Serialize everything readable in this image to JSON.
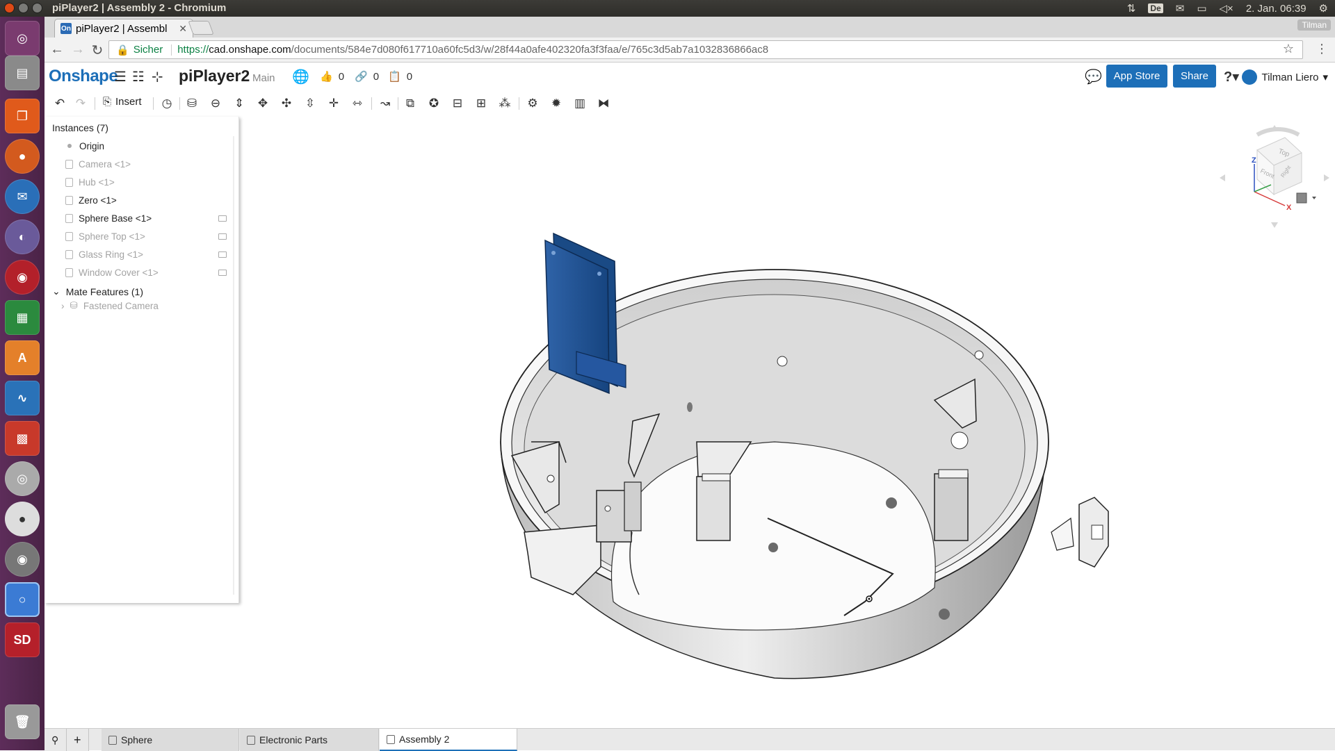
{
  "os": {
    "window_title": "piPlayer2 | Assembly 2 - Chromium",
    "keyboard_layout": "De",
    "datetime": "2. Jan. 06:39"
  },
  "browser": {
    "tab_title": "piPlayer2 | Assembl",
    "tab_favicon": "On",
    "profile": "Tilman",
    "secure_label": "Sicher",
    "url_scheme": "https://",
    "url_host": "cad.onshape.com",
    "url_path": "/documents/584e7d080f617710a60fc5d3/w/28f44a0afe402320fa3f3faa/e/765c3d5ab7a1032836866ac8"
  },
  "onshape": {
    "logo": "Onshape",
    "document_title": "piPlayer2",
    "branch": "Main",
    "likes": "0",
    "links": "0",
    "copies": "0",
    "app_store": "App Store",
    "share": "Share",
    "help": "?",
    "user": "Tilman Liero",
    "toolbar_insert": "Insert"
  },
  "instances": {
    "title": "Instances (7)",
    "items": [
      {
        "label": "Origin",
        "state": "origin"
      },
      {
        "label": "Camera <1>",
        "state": "dim"
      },
      {
        "label": "Hub <1>",
        "state": "dim"
      },
      {
        "label": "Zero <1>",
        "state": "solid"
      },
      {
        "label": "Sphere Base <1>",
        "state": "solid"
      },
      {
        "label": "Sphere Top <1>",
        "state": "dim"
      },
      {
        "label": "Glass Ring <1>",
        "state": "dim"
      },
      {
        "label": "Window Cover <1>",
        "state": "dim"
      }
    ],
    "mate_title": "Mate Features (1)",
    "mate_item": "Fastened Camera"
  },
  "viewcube": {
    "top": "Top",
    "front": "Front",
    "right": "Right",
    "axis_z": "Z",
    "axis_x": "X"
  },
  "bottom_tabs": [
    {
      "label": "Sphere",
      "active": false
    },
    {
      "label": "Electronic Parts",
      "active": false
    },
    {
      "label": "Assembly 2",
      "active": true
    }
  ],
  "colors": {
    "brand": "#1d6fb8",
    "part_blue": "#1f4f8c",
    "model_gray": "#d9d9d9"
  }
}
